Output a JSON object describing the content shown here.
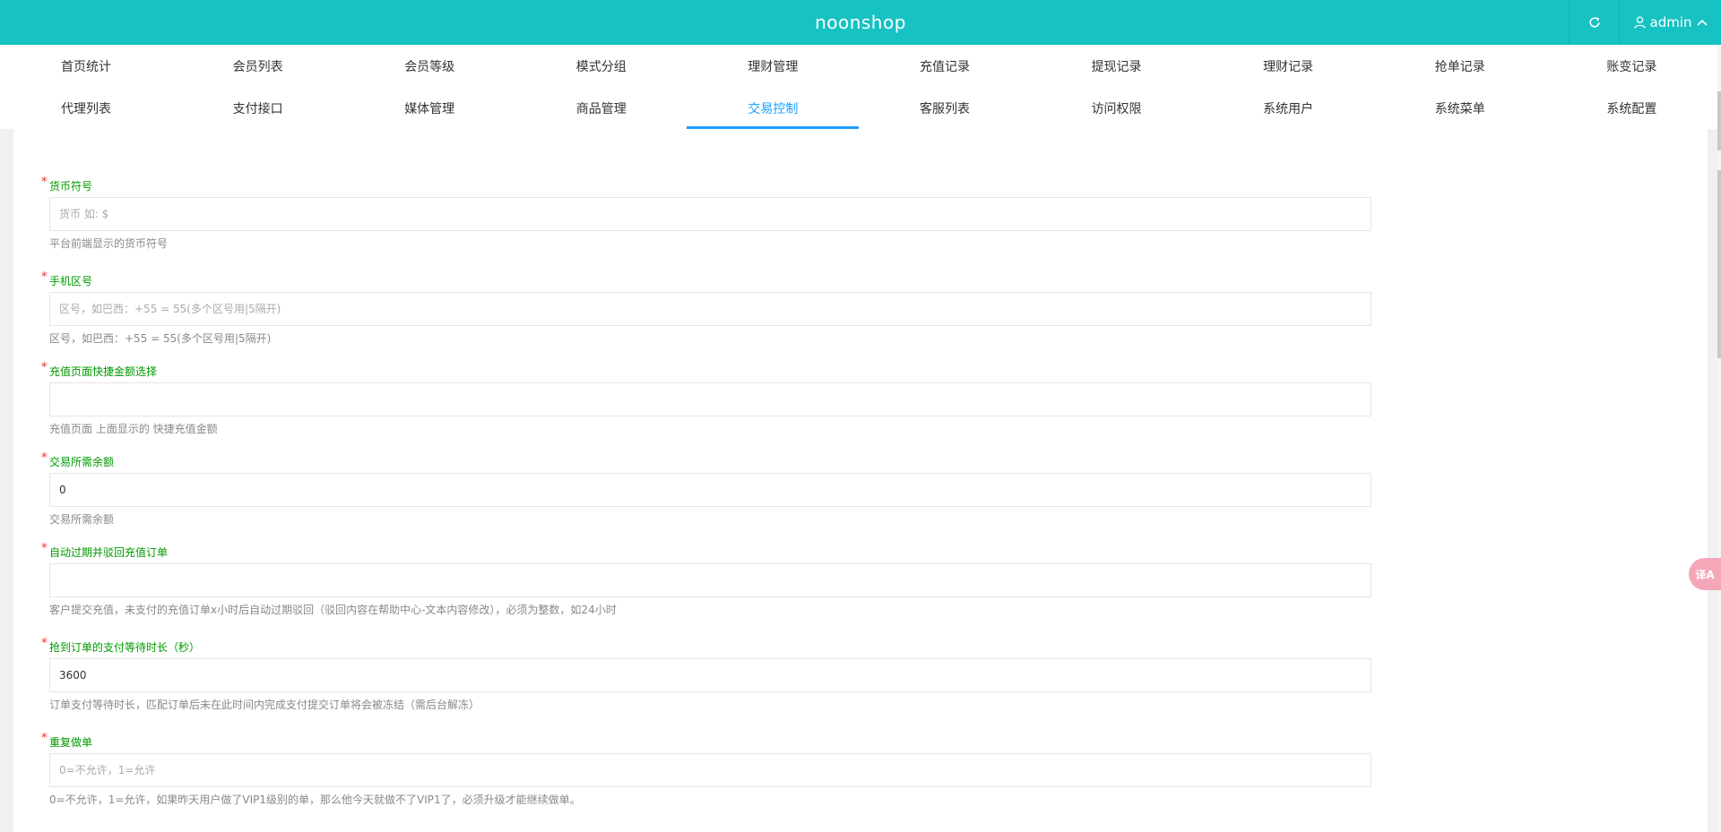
{
  "header": {
    "brand": "noonshop",
    "user": "admin"
  },
  "nav": {
    "row1": [
      "首页统计",
      "会员列表",
      "会员等级",
      "模式分组",
      "理财管理",
      "充值记录",
      "提现记录",
      "理财记录",
      "抢单记录",
      "账变记录"
    ],
    "row2": [
      "代理列表",
      "支付接口",
      "媒体管理",
      "商品管理",
      "交易控制",
      "客服列表",
      "访问权限",
      "系统用户",
      "系统菜单",
      "系统配置"
    ],
    "active": "交易控制"
  },
  "form": {
    "fields": [
      {
        "label": "货币符号",
        "value": "",
        "placeholder": "货币 如: $",
        "help": "平台前端显示的货币符号"
      },
      {
        "label": "手机区号",
        "value": "",
        "placeholder": "区号，如巴西：+55 = 55(多个区号用|5隔开)",
        "help": "区号，如巴西：+55 = 55(多个区号用|5隔开)"
      },
      {
        "label": "充值页面快捷金额选择",
        "value": "",
        "placeholder": "",
        "help": "充值页面 上面显示的 快捷充值金额"
      },
      {
        "label": "交易所需余额",
        "value": "0",
        "placeholder": "",
        "help": "交易所需余额"
      },
      {
        "label": "自动过期并驳回充值订单",
        "value": "",
        "placeholder": "",
        "help": "客户提交充值，未支付的充值订单x小时后自动过期驳回（驳回内容在帮助中心-文本内容修改），必须为整数，如24小时"
      },
      {
        "label": "抢到订单的支付等待时长（秒）",
        "value": "3600",
        "placeholder": "",
        "help": "订单支付等待时长，匹配订单后未在此时间内完成支付提交订单将会被冻结（需后台解冻）"
      },
      {
        "label": "重复做单",
        "value": "",
        "placeholder": "0=不允许，1=允许",
        "help": "0=不允许，1=允许，如果昨天用户做了VIP1级别的单，那么他今天就做不了VIP1了，必须升级才能继续做单。"
      }
    ]
  },
  "floating": {
    "translate_icon": "translate-icon"
  },
  "colors": {
    "header": "#16c2c2",
    "active_tab": "#1e9fff",
    "label": "#009900",
    "required": "#ff2222"
  }
}
